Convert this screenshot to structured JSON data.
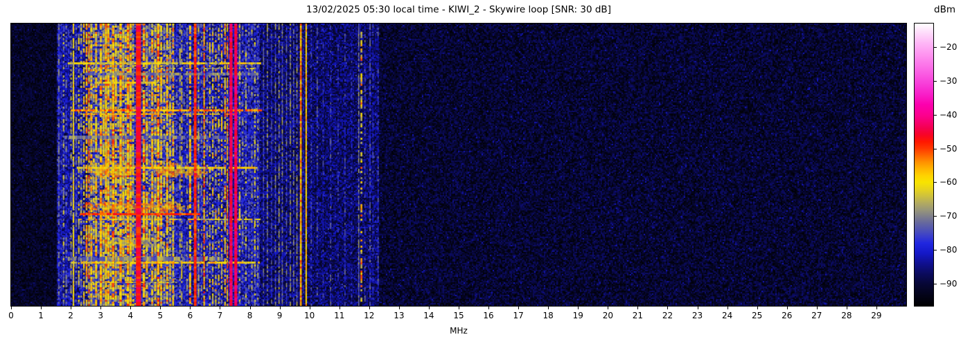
{
  "chart_data": {
    "type": "heatmap",
    "subtype": "radio-spectrum-waterfall",
    "title": "13/02/2025 05:30 local time - KIWI_2 - Skywire loop [SNR: 30 dB]",
    "xlabel": "MHz",
    "value_label": "dBm",
    "x_range": [
      0,
      30
    ],
    "x_ticks": [
      "0",
      "1",
      "2",
      "3",
      "4",
      "5",
      "6",
      "7",
      "8",
      "9",
      "10",
      "11",
      "12",
      "13",
      "14",
      "15",
      "16",
      "17",
      "18",
      "19",
      "20",
      "21",
      "22",
      "23",
      "24",
      "25",
      "26",
      "27",
      "28",
      "29"
    ],
    "y_axis_tick_labels": [],
    "grid": false,
    "legend_position": "none",
    "colorbar": {
      "top_value": -13,
      "bottom_value": -96.6,
      "ticks": [
        {
          "label": "−20",
          "value": -20
        },
        {
          "label": "−30",
          "value": -30
        },
        {
          "label": "−40",
          "value": -40
        },
        {
          "label": "−50",
          "value": -50
        },
        {
          "label": "−60",
          "value": -60
        },
        {
          "label": "−70",
          "value": -70
        },
        {
          "label": "−80",
          "value": -80
        },
        {
          "label": "−90",
          "value": -90
        }
      ]
    },
    "colormap_stops": [
      {
        "v": -96.6,
        "c": "#000000"
      },
      {
        "v": -93,
        "c": "#04041c"
      },
      {
        "v": -90,
        "c": "#070736"
      },
      {
        "v": -87,
        "c": "#0b0b5e"
      },
      {
        "v": -84,
        "c": "#101090"
      },
      {
        "v": -81,
        "c": "#1418c8"
      },
      {
        "v": -78,
        "c": "#2026e0"
      },
      {
        "v": -76,
        "c": "#3a3ecc"
      },
      {
        "v": -74,
        "c": "#5054b4"
      },
      {
        "v": -72,
        "c": "#66689e"
      },
      {
        "v": -70,
        "c": "#80808a"
      },
      {
        "v": -68,
        "c": "#9a9878"
      },
      {
        "v": -66,
        "c": "#b4ac5e"
      },
      {
        "v": -64,
        "c": "#cfc23c"
      },
      {
        "v": -62,
        "c": "#e8d41c"
      },
      {
        "v": -60,
        "c": "#f8e400"
      },
      {
        "v": -58,
        "c": "#ffd200"
      },
      {
        "v": -56,
        "c": "#ffb400"
      },
      {
        "v": -54,
        "c": "#ff9000"
      },
      {
        "v": -52,
        "c": "#ff6400"
      },
      {
        "v": -50,
        "c": "#ff3800"
      },
      {
        "v": -48,
        "c": "#ff1800"
      },
      {
        "v": -46,
        "c": "#f80426"
      },
      {
        "v": -44,
        "c": "#f4004e"
      },
      {
        "v": -42,
        "c": "#f80072"
      },
      {
        "v": -40,
        "c": "#fc0090"
      },
      {
        "v": -37,
        "c": "#fc00ae"
      },
      {
        "v": -34,
        "c": "#f81ec8"
      },
      {
        "v": -31,
        "c": "#f83cd8"
      },
      {
        "v": -28,
        "c": "#fa5ae2"
      },
      {
        "v": -25,
        "c": "#fc78ea"
      },
      {
        "v": -22,
        "c": "#fe96f0"
      },
      {
        "v": -19,
        "c": "#feb4f6"
      },
      {
        "v": -16,
        "c": "#fed8fa"
      },
      {
        "v": -13,
        "c": "#ffffff"
      }
    ],
    "seed": 1337,
    "noise_regions_format": [
      "f0_mhz",
      "f1_mhz",
      "mean_dbm",
      "variation_db"
    ],
    "noise_regions": [
      [
        0.0,
        1.55,
        -92,
        4
      ],
      [
        1.55,
        2.62,
        -84,
        7
      ],
      [
        2.62,
        5.5,
        -79,
        10
      ],
      [
        5.5,
        8.35,
        -82,
        8
      ],
      [
        8.35,
        12.35,
        -87,
        6
      ],
      [
        12.35,
        30.0,
        -91,
        5
      ]
    ],
    "columns_format": [
      "f_mhz",
      "width_mhz",
      "level_dbm",
      "variation_db",
      "duty",
      "draw_on_top"
    ],
    "columns": [
      [
        1.6,
        0.05,
        -74,
        6,
        0.85,
        0
      ],
      [
        1.68,
        0.04,
        -79,
        6,
        0.9,
        0
      ],
      [
        1.76,
        0.05,
        -70,
        8,
        0.6,
        0
      ],
      [
        1.85,
        0.06,
        -77,
        8,
        0.85,
        0
      ],
      [
        1.93,
        0.05,
        -81,
        6,
        0.9,
        0
      ],
      [
        2.01,
        0.04,
        -67,
        8,
        0.6,
        0
      ],
      [
        2.09,
        0.05,
        -61,
        5,
        0.95,
        0
      ],
      [
        2.18,
        0.05,
        -76,
        8,
        0.85,
        0
      ],
      [
        2.27,
        0.05,
        -64,
        8,
        0.6,
        0
      ],
      [
        2.35,
        0.06,
        -73,
        10,
        0.85,
        0
      ],
      [
        2.44,
        0.05,
        -62,
        8,
        0.7,
        0
      ],
      [
        2.53,
        0.06,
        -58,
        8,
        0.8,
        0
      ],
      [
        2.61,
        0.05,
        -56,
        8,
        0.8,
        0
      ],
      [
        2.69,
        0.07,
        -62,
        10,
        0.85,
        0
      ],
      [
        2.77,
        0.06,
        -71,
        12,
        0.9,
        0
      ],
      [
        2.85,
        0.07,
        -60,
        8,
        0.8,
        0
      ],
      [
        2.93,
        0.06,
        -75,
        10,
        0.9,
        0
      ],
      [
        3.01,
        0.08,
        -58,
        8,
        0.85,
        0
      ],
      [
        3.1,
        0.06,
        -65,
        10,
        0.8,
        0
      ],
      [
        3.18,
        0.07,
        -57,
        7,
        0.9,
        0
      ],
      [
        3.26,
        0.07,
        -60,
        9,
        0.85,
        0
      ],
      [
        3.34,
        0.06,
        -69,
        12,
        0.8,
        0
      ],
      [
        3.42,
        0.08,
        -56,
        7,
        0.9,
        0
      ],
      [
        3.51,
        0.07,
        -62,
        10,
        0.85,
        0
      ],
      [
        3.59,
        0.06,
        -73,
        12,
        0.85,
        0
      ],
      [
        3.67,
        0.08,
        -57,
        8,
        0.9,
        0
      ],
      [
        3.76,
        0.07,
        -61,
        9,
        0.8,
        0
      ],
      [
        3.84,
        0.06,
        -68,
        10,
        0.8,
        0
      ],
      [
        3.92,
        0.08,
        -56,
        8,
        0.9,
        0
      ],
      [
        4.01,
        0.07,
        -60,
        9,
        0.85,
        0
      ],
      [
        4.09,
        0.06,
        -66,
        10,
        0.8,
        0
      ],
      [
        4.27,
        0.17,
        -47,
        4,
        1.0,
        1
      ],
      [
        4.45,
        0.08,
        -57,
        8,
        0.85,
        0
      ],
      [
        4.55,
        0.07,
        -62,
        10,
        0.8,
        0
      ],
      [
        4.64,
        0.06,
        -71,
        10,
        0.8,
        0
      ],
      [
        4.73,
        0.07,
        -59,
        8,
        0.85,
        0
      ],
      [
        4.83,
        0.07,
        -63,
        10,
        0.8,
        0
      ],
      [
        4.93,
        0.08,
        -56,
        8,
        0.9,
        0
      ],
      [
        5.03,
        0.07,
        -60,
        9,
        0.8,
        0
      ],
      [
        5.13,
        0.06,
        -69,
        12,
        0.8,
        0
      ],
      [
        5.23,
        0.07,
        -59,
        9,
        0.85,
        0
      ],
      [
        5.33,
        0.06,
        -64,
        10,
        0.8,
        0
      ],
      [
        5.43,
        0.06,
        -60,
        9,
        0.8,
        0
      ],
      [
        5.55,
        0.06,
        -77,
        8,
        0.9,
        0
      ],
      [
        5.66,
        0.05,
        -72,
        10,
        0.85,
        0
      ],
      [
        5.72,
        0.04,
        -63,
        8,
        0.6,
        0
      ],
      [
        5.8,
        0.05,
        -78,
        8,
        0.9,
        0
      ],
      [
        5.9,
        0.05,
        -74,
        10,
        0.85,
        0
      ],
      [
        6.0,
        0.07,
        -58,
        8,
        0.8,
        0
      ],
      [
        6.17,
        0.09,
        -49,
        4,
        1.0,
        1
      ],
      [
        6.28,
        0.05,
        -70,
        10,
        0.8,
        0
      ],
      [
        6.38,
        0.04,
        -74,
        10,
        0.85,
        0
      ],
      [
        6.47,
        0.05,
        -54,
        7,
        0.85,
        0
      ],
      [
        6.57,
        0.05,
        -73,
        10,
        0.8,
        0
      ],
      [
        6.66,
        0.05,
        -66,
        10,
        0.6,
        0
      ],
      [
        6.76,
        0.05,
        -63,
        10,
        0.6,
        0
      ],
      [
        6.86,
        0.05,
        -62,
        10,
        0.55,
        0
      ],
      [
        6.96,
        0.05,
        -65,
        10,
        0.6,
        0
      ],
      [
        7.06,
        0.05,
        -62,
        10,
        0.6,
        0
      ],
      [
        7.17,
        0.05,
        -58,
        9,
        0.7,
        0
      ],
      [
        7.25,
        0.04,
        -56,
        8,
        0.8,
        0
      ],
      [
        7.37,
        0.1,
        -44,
        3,
        1.0,
        1
      ],
      [
        7.53,
        0.1,
        -44,
        3,
        1.0,
        1
      ],
      [
        7.66,
        0.05,
        -68,
        10,
        0.7,
        0
      ],
      [
        7.76,
        0.05,
        -75,
        10,
        0.85,
        0
      ],
      [
        7.87,
        0.05,
        -70,
        10,
        0.7,
        0
      ],
      [
        7.97,
        0.05,
        -77,
        8,
        0.85,
        0
      ],
      [
        8.07,
        0.05,
        -73,
        10,
        0.8,
        0
      ],
      [
        8.17,
        0.05,
        -69,
        10,
        0.7,
        0
      ],
      [
        8.27,
        0.05,
        -74,
        10,
        0.8,
        0
      ],
      [
        8.46,
        0.03,
        -76,
        8,
        0.9,
        0
      ],
      [
        8.59,
        0.03,
        -71,
        8,
        0.85,
        0
      ],
      [
        8.73,
        0.03,
        -77,
        8,
        0.9,
        0
      ],
      [
        8.86,
        0.03,
        -73,
        8,
        0.85,
        0
      ],
      [
        8.98,
        0.03,
        -69,
        8,
        0.8,
        0
      ],
      [
        9.09,
        0.03,
        -72,
        8,
        0.9,
        0
      ],
      [
        9.23,
        0.03,
        -75,
        8,
        0.85,
        0
      ],
      [
        9.36,
        0.03,
        -70,
        8,
        0.8,
        0
      ],
      [
        9.47,
        0.03,
        -74,
        8,
        0.85,
        0
      ],
      [
        9.58,
        0.03,
        -70,
        8,
        0.8,
        0
      ],
      [
        9.71,
        0.06,
        -55,
        5,
        1.0,
        1
      ],
      [
        9.8,
        0.03,
        -81,
        6,
        0.9,
        0
      ],
      [
        9.89,
        0.05,
        -58,
        5,
        1.0,
        1
      ],
      [
        10.06,
        0.03,
        -79,
        8,
        0.7,
        0
      ],
      [
        10.26,
        0.03,
        -76,
        8,
        0.6,
        0
      ],
      [
        10.46,
        0.03,
        -81,
        8,
        0.7,
        0
      ],
      [
        10.71,
        0.03,
        -77,
        8,
        0.6,
        0
      ],
      [
        10.96,
        0.03,
        -80,
        8,
        0.6,
        0
      ],
      [
        11.19,
        0.03,
        -77,
        8,
        0.6,
        0
      ],
      [
        11.41,
        0.03,
        -81,
        8,
        0.6,
        0
      ],
      [
        11.65,
        0.03,
        -71,
        6,
        0.9,
        0
      ],
      [
        11.74,
        0.06,
        -60,
        10,
        0.55,
        0
      ],
      [
        11.86,
        0.03,
        -77,
        8,
        0.7,
        0
      ],
      [
        12.03,
        0.04,
        -77,
        8,
        0.8,
        0
      ],
      [
        12.13,
        0.04,
        -80,
        8,
        0.8,
        0
      ],
      [
        12.3,
        0.04,
        -78,
        8,
        0.7,
        0
      ]
    ],
    "streaks_format": [
      "f0_mhz",
      "f1_mhz",
      "y_fraction",
      "height_px",
      "level_dbm",
      "variation_db",
      "duty"
    ],
    "streaks": [
      [
        1.9,
        8.35,
        0.138,
        3,
        -62,
        6,
        0.9
      ],
      [
        2.3,
        8.3,
        0.158,
        2,
        -68,
        8,
        0.8
      ],
      [
        2.5,
        8.3,
        0.175,
        4,
        -71,
        6,
        0.9
      ],
      [
        2.8,
        4.8,
        0.205,
        3,
        -61,
        7,
        0.8
      ],
      [
        2.0,
        8.35,
        0.303,
        3,
        -54,
        5,
        0.95
      ],
      [
        2.4,
        7.6,
        0.318,
        2,
        -58,
        6,
        0.8
      ],
      [
        1.8,
        7.2,
        0.398,
        5,
        -71,
        6,
        0.9
      ],
      [
        2.2,
        8.2,
        0.508,
        3,
        -60,
        6,
        0.85
      ],
      [
        2.3,
        6.3,
        0.672,
        3,
        -50,
        4,
        1.0
      ],
      [
        2.3,
        8.3,
        0.69,
        2,
        -62,
        8,
        0.7
      ],
      [
        1.9,
        7.0,
        0.825,
        6,
        -70,
        6,
        0.85
      ],
      [
        2.0,
        8.3,
        0.843,
        3,
        -60,
        6,
        0.9
      ],
      [
        2.5,
        5.5,
        0.915,
        2,
        -64,
        8,
        0.7
      ]
    ],
    "blobs_format": [
      "f0_mhz",
      "f1_mhz",
      "y0_fraction",
      "y1_fraction",
      "level_dbm"
    ],
    "blobs": [
      [
        2.5,
        4.25,
        0.487,
        0.545,
        -57
      ],
      [
        4.5,
        6.6,
        0.487,
        0.545,
        -56
      ],
      [
        2.2,
        6.1,
        0.622,
        0.672,
        -55
      ],
      [
        2.9,
        5.3,
        0.752,
        0.792,
        -63
      ]
    ]
  }
}
